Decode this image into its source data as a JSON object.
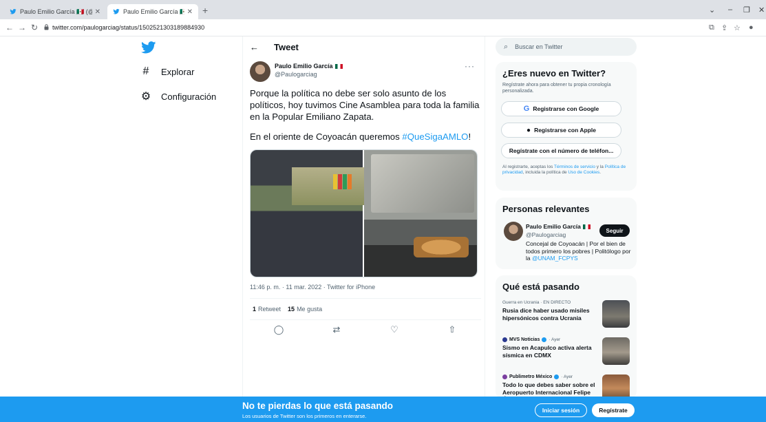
{
  "browser": {
    "tabs": [
      {
        "label": "Paulo Emilio García 🇲🇽 (@Paulog"
      },
      {
        "label": "Paulo Emilio García 🇲🇽 en Twitte"
      }
    ],
    "new_tab": "+",
    "url": "twitter.com/paulogarciag/status/1502521303189884930"
  },
  "nav": {
    "items": [
      {
        "label": "Explorar",
        "icon": "hashtag-icon"
      },
      {
        "label": "Configuración",
        "icon": "gear-icon"
      }
    ]
  },
  "tweet": {
    "header": "Tweet",
    "author_name": "Paulo Emilio García",
    "author_handle": "@Paulogarciag",
    "more": "···",
    "text_1": "Porque la política no debe ser solo asunto de los políticos, hoy tuvimos Cine Asamblea para toda la familia en la Popular Emiliano Zapata.",
    "text_2_prefix": "En el oriente de Coyoacán queremos ",
    "hashtag": "#QueSigaAMLO",
    "text_2_suffix": "!",
    "timestamp": "11:46 p. m. · 11 mar. 2022 · Twitter for iPhone",
    "retweets_count": "1",
    "retweets_label": "Retweet",
    "likes_count": "15",
    "likes_label": "Me gusta"
  },
  "search": {
    "placeholder": "Buscar en Twitter"
  },
  "signup_card": {
    "title": "¿Eres nuevo en Twitter?",
    "subtitle": "Regístrate ahora para obtener tu propia cronología personalizada.",
    "google_label": "Registrarse con Google",
    "apple_label": "Registrarse con Apple",
    "phone_label": "Regístrate con el número de teléfon...",
    "legal_1": "Al registrarte, aceptas los ",
    "legal_terms": "Términos de servicio",
    "legal_2": " y la ",
    "legal_privacy": "Política de privacidad",
    "legal_3": ", incluida la política de ",
    "legal_cookies": "Uso de Cookies",
    "legal_4": "."
  },
  "relevant": {
    "title": "Personas relevantes",
    "name": "Paulo Emilio García",
    "handle": "@Paulogarciag",
    "follow_label": "Seguir",
    "bio": "Concejal de Coyoacán | Por el bien de todos primero los pobres | Politólogo por la ",
    "bio_link": "@UNAM_FCPYS"
  },
  "trending": {
    "title": "Qué está pasando",
    "items": [
      {
        "meta": "Guerra en Ucrania · EN DIRECTO",
        "headline": "Rusia dice haber usado misiles hipersónicos contra Ucrania"
      },
      {
        "source": "MVS Noticias",
        "time": "· Ayer",
        "headline": "Sismo en Acapulco activa alerta sísmica en CDMX"
      },
      {
        "source": "Publimetro México",
        "time": "· Ayer",
        "headline": "Todo lo que debes saber sobre el Aeropuerto Internacional Felipe Ángeles"
      }
    ]
  },
  "banner": {
    "title": "No te pierdas lo que está pasando",
    "subtitle": "Los usuarios de Twitter son los primeros en enterarse.",
    "login_label": "Iniciar sesión",
    "signup_label": "Regístrate"
  },
  "colors": {
    "twitter_blue": "#1d9bf0",
    "text": "#0f1419",
    "muted": "#536471"
  }
}
